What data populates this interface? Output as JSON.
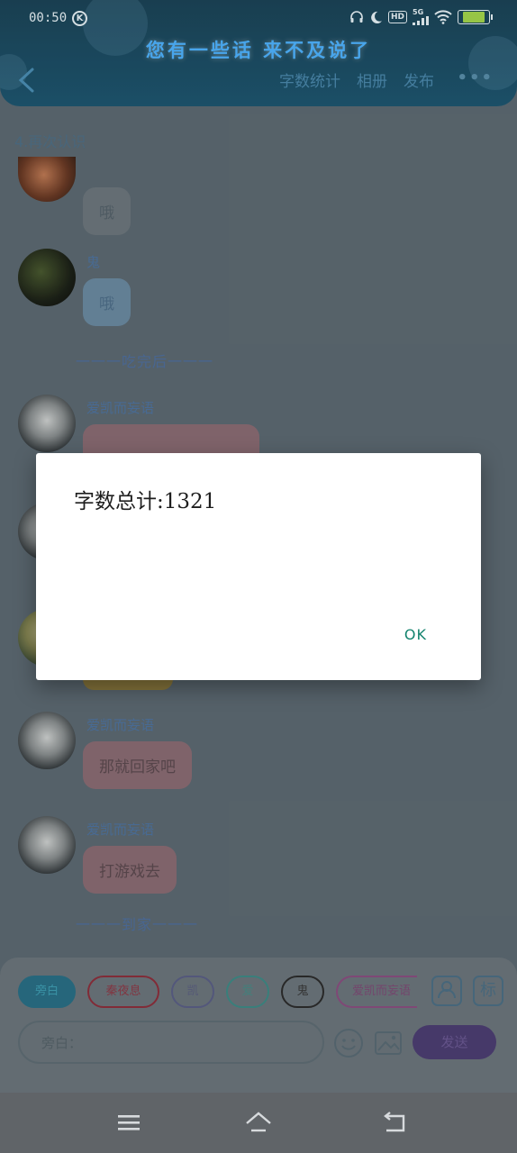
{
  "status_bar": {
    "time": "00:50",
    "k_label": "K",
    "hd_label": "HD",
    "network_label": "5G"
  },
  "header": {
    "title": "您有一些话 来不及说了",
    "links": [
      "字数统计",
      "相册",
      "发布"
    ],
    "more": "•••"
  },
  "chat": {
    "conversation_title": "4.再次认识",
    "messages": [
      {
        "sender": "",
        "text": "哦"
      },
      {
        "sender": "鬼",
        "text": "哦"
      },
      {
        "sender": "爱凯而妄语",
        "text": ""
      },
      {
        "sender": "爱凯而妄语",
        "text": "那就回家吧"
      },
      {
        "sender": "爱凯而妄语",
        "text": "打游戏去"
      }
    ],
    "notices": [
      "一一一吃完后一一一",
      "一一一到家一一一"
    ]
  },
  "composer": {
    "chips": [
      "旁白",
      "秦夜息",
      "凯",
      "爱",
      "鬼",
      "爱凯而妄语"
    ],
    "tag_button": "标",
    "input_placeholder": "旁白：",
    "send_label": "发送"
  },
  "dialog": {
    "message": "字数总计:1321",
    "ok_label": "OK"
  },
  "colors": {
    "accent_title": "#4fb4ff",
    "dialog_ok": "#13836e",
    "send_button": "#4d3e72"
  }
}
